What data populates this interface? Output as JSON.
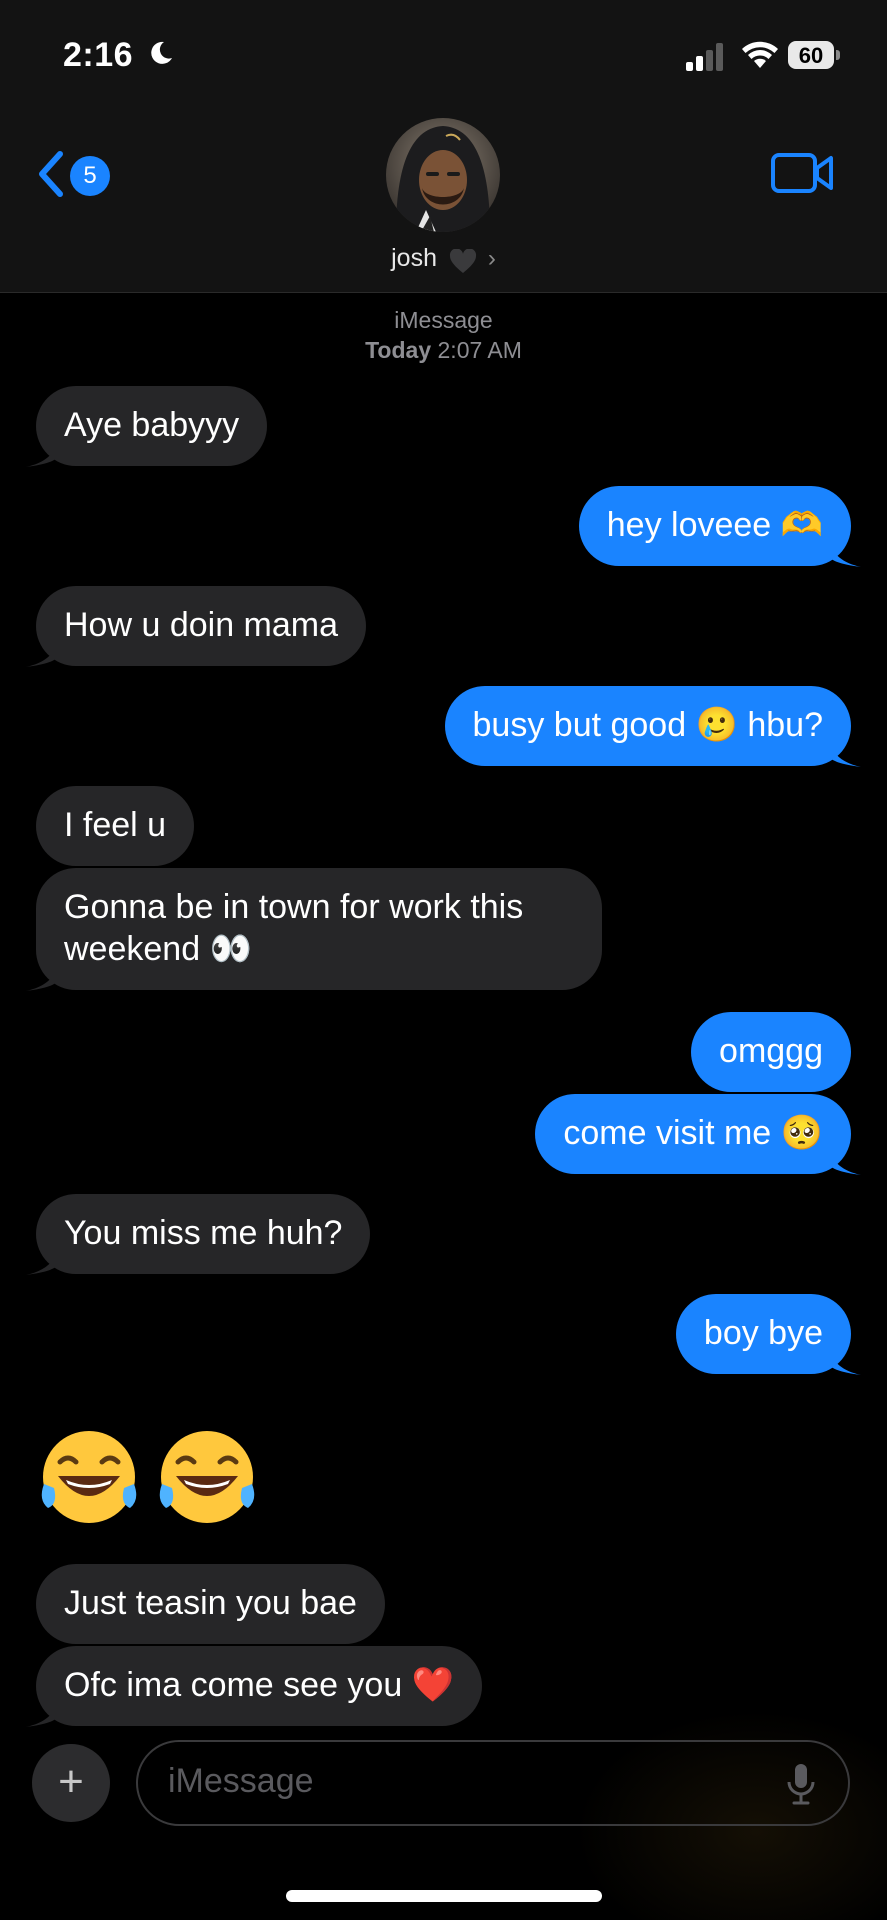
{
  "status": {
    "time": "2:16",
    "battery": "60"
  },
  "header": {
    "unread_count": "5",
    "contact_name": "josh",
    "chevron": "›"
  },
  "thread_meta": {
    "service": "iMessage",
    "day": "Today",
    "time": "2:07 AM"
  },
  "messages": [
    {
      "direction": "incoming",
      "text": "Aye babyyy"
    },
    {
      "direction": "outgoing",
      "text": "hey loveee 🫶"
    },
    {
      "direction": "incoming",
      "text": "How u doin mama"
    },
    {
      "direction": "outgoing",
      "text": "busy but good 🥲 hbu?"
    },
    {
      "direction": "incoming",
      "text": "I feel u"
    },
    {
      "direction": "incoming",
      "text": "Gonna be in town for work this weekend 👀"
    },
    {
      "direction": "outgoing",
      "text": "omggg"
    },
    {
      "direction": "outgoing",
      "text": "come visit me 🥺"
    },
    {
      "direction": "incoming",
      "text": "You miss me huh?"
    },
    {
      "direction": "outgoing",
      "text": "boy bye"
    },
    {
      "direction": "incoming",
      "text": "😂😂"
    },
    {
      "direction": "incoming",
      "text": "Just teasin you bae"
    },
    {
      "direction": "incoming",
      "text": "Ofc ima come see you ❤️"
    }
  ],
  "compose": {
    "placeholder": "iMessage",
    "add_label": "+"
  },
  "icons": [
    "moon-icon",
    "signal-icon",
    "wifi-icon",
    "battery-icon",
    "back-chevron-icon",
    "heart-icon",
    "video-camera-icon",
    "plus-icon",
    "microphone-icon"
  ],
  "colors": {
    "outgoing_bubble": "#1a84ff",
    "incoming_bubble": "#262628",
    "background": "#000000",
    "header": "#131313"
  }
}
